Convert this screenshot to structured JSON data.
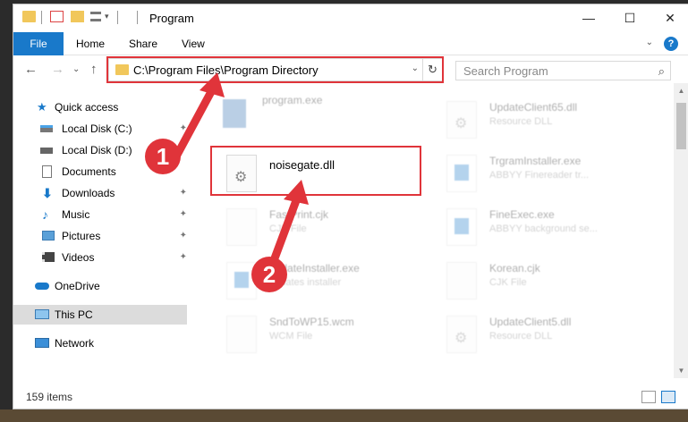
{
  "window": {
    "title": "Program",
    "minimize": "—",
    "maximize": "☐",
    "close": "✕"
  },
  "ribbon": {
    "tabs": [
      "File",
      "Home",
      "Share",
      "View"
    ],
    "expand": "⌄",
    "help": "?"
  },
  "nav": {
    "back": "←",
    "forward": "→",
    "recent": "⌄",
    "up": "↑",
    "address": "C:\\Program Files\\Program Directory",
    "address_dropdown": "⌄",
    "refresh": "↻",
    "search_placeholder": "Search Program",
    "search_icon": "⌕"
  },
  "sidebar": {
    "items": [
      {
        "label": "Quick access",
        "icon": "star-icon"
      },
      {
        "label": "Local Disk (C:)",
        "icon": "drive-icon"
      },
      {
        "label": "Local Disk (D:)",
        "icon": "drive-icon"
      },
      {
        "label": "Documents",
        "icon": "documents-icon"
      },
      {
        "label": "Downloads",
        "icon": "download-icon"
      },
      {
        "label": "Music",
        "icon": "music-icon"
      },
      {
        "label": "Pictures",
        "icon": "pictures-icon"
      },
      {
        "label": "Videos",
        "icon": "videos-icon"
      },
      {
        "label": "OneDrive",
        "icon": "cloud-icon"
      },
      {
        "label": "This PC",
        "icon": "computer-icon"
      },
      {
        "label": "Network",
        "icon": "network-icon"
      }
    ],
    "pin": "📌",
    "pin_text": "✦"
  },
  "files": {
    "left": [
      {
        "name": "program.exe",
        "type": ""
      },
      {
        "name": "noisegate.dll",
        "type": ""
      },
      {
        "name": "FastPrint.cjk",
        "type": "CJK File"
      },
      {
        "name": "updateInstaller.exe",
        "type": "updates installer"
      },
      {
        "name": "SndToWP15.wcm",
        "type": "WCM File"
      }
    ],
    "right": [
      {
        "name": "UpdateClient65.dll",
        "type": "Resource DLL"
      },
      {
        "name": "TrgramInstaller.exe",
        "type": "ABBYY Finereader tr..."
      },
      {
        "name": "FineExec.exe",
        "type": "ABBYY background se..."
      },
      {
        "name": "Korean.cjk",
        "type": "CJK File"
      },
      {
        "name": "UpdateClient5.dll",
        "type": "Resource DLL"
      }
    ]
  },
  "annotations": {
    "step1": "1",
    "step2": "2"
  },
  "status": {
    "count": "159 items"
  },
  "colors": {
    "accent": "#1979ca",
    "highlight": "#e0343a",
    "folder": "#f1c75b"
  }
}
